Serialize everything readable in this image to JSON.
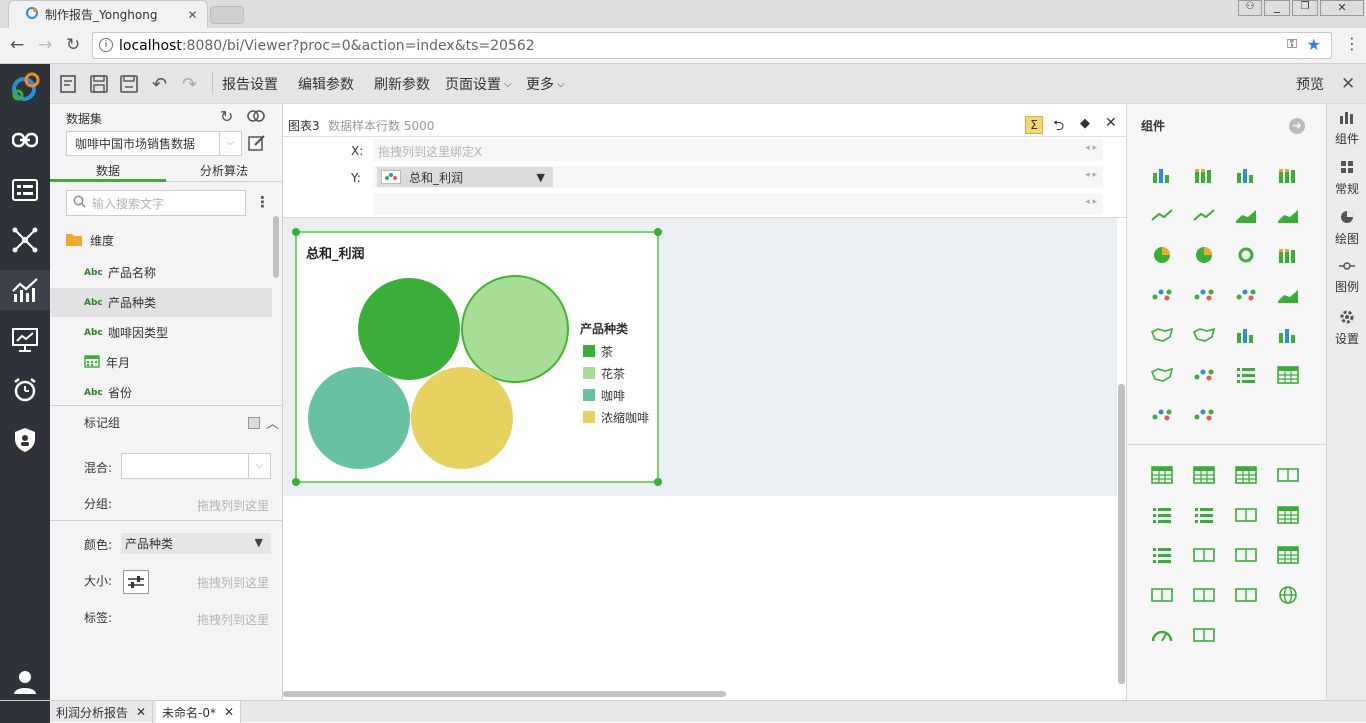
{
  "browser": {
    "tab_title": "制作报告_Yonghong",
    "url_host": "localhost",
    "url_rest": ":8080/bi/Viewer?proc=0&action=index&ts=20562"
  },
  "toolbar": {
    "report_settings": "报告设置",
    "edit_params": "编辑参数",
    "refresh_params": "刷新参数",
    "page_settings": "页面设置",
    "more": "更多",
    "preview": "预览"
  },
  "left": {
    "dataset_label": "数据集",
    "dataset_value": "咖啡中国市场销售数据",
    "tab_data": "数据",
    "tab_algo": "分析算法",
    "search_placeholder": "输入搜索文字",
    "folder": "维度",
    "fields": [
      {
        "type": "Abc",
        "name": "产品名称"
      },
      {
        "type": "Abc",
        "name": "产品种类"
      },
      {
        "type": "Abc",
        "name": "咖啡因类型"
      },
      {
        "type": "cal",
        "name": "年月"
      },
      {
        "type": "Abc",
        "name": "省份"
      }
    ],
    "marks_group": "标记组",
    "mix_label": "混合:",
    "group_label": "分组:",
    "drag_hint": "拖拽列到这里",
    "color_label": "颜色:",
    "color_value": "产品种类",
    "size_label": "大小:",
    "tag_label": "标签:"
  },
  "center": {
    "chart_name": "图表3",
    "sample_rows": "数据样本行数 5000",
    "x_label": "X:",
    "x_hint": "拖拽列到这里绑定X",
    "y_label": "Y:",
    "y_value": "总和_利润"
  },
  "chart_data": {
    "type": "scatter",
    "title": "总和_利润",
    "legend_title": "产品种类",
    "legend_position": "right",
    "series": [
      {
        "name": "茶",
        "color": "#3aae38"
      },
      {
        "name": "花茶",
        "color": "#a8dd98"
      },
      {
        "name": "咖啡",
        "color": "#68c2a1"
      },
      {
        "name": "浓缩咖啡",
        "color": "#e7d161"
      }
    ]
  },
  "right": {
    "components_title": "组件",
    "side_tabs": [
      "组件",
      "常规",
      "绘图",
      "图例",
      "设置"
    ]
  },
  "bottom_tabs": [
    "利润分析报告",
    "未命名-0*"
  ],
  "colors": {
    "accent": "#3aae38",
    "nav_bg": "#2e3239"
  }
}
